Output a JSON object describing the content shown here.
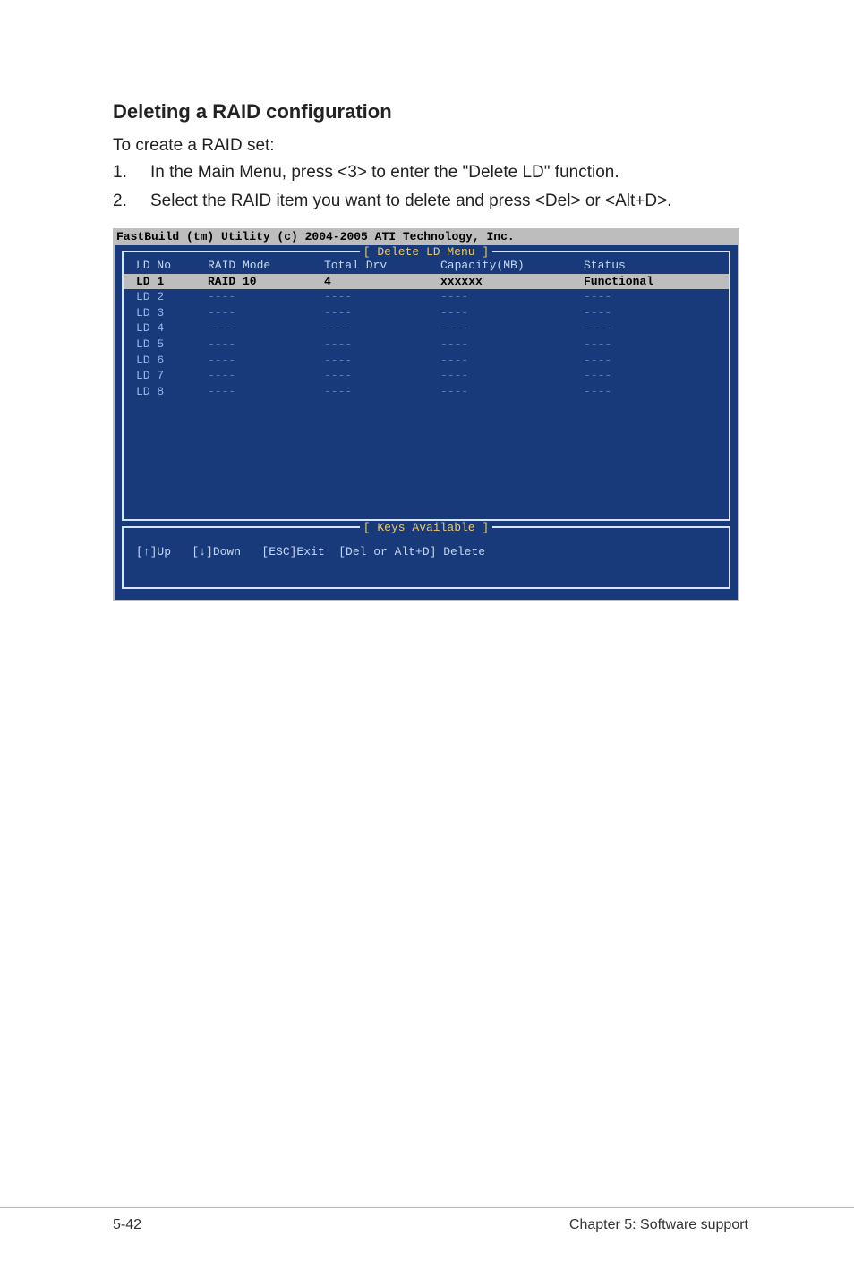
{
  "heading": "Deleting a RAID configuration",
  "intro": "To create a RAID set:",
  "steps": [
    {
      "num": "1.",
      "text": "In the Main Menu, press <3> to enter the \"Delete LD\" function."
    },
    {
      "num": "2.",
      "text": "Select the RAID item you want to delete and press <Del> or <Alt+D>."
    }
  ],
  "terminal": {
    "util_title": "FastBuild (tm) Utility (c) 2004-2005 ATI Technology, Inc.",
    "menu_title": "[ Delete LD Menu ]",
    "columns": {
      "c1": "LD No",
      "c2": "RAID Mode",
      "c3": "Total Drv",
      "c4": "Capacity(MB)",
      "c5": "Status"
    },
    "rows": [
      {
        "c1": "LD 1",
        "c2": "RAID 10",
        "c3": "4",
        "c4": "xxxxxx",
        "c5": "Functional",
        "selected": true
      },
      {
        "c1": "LD 2",
        "c2": "----",
        "c3": "----",
        "c4": "----",
        "c5": "----"
      },
      {
        "c1": "LD 3",
        "c2": "----",
        "c3": "----",
        "c4": "----",
        "c5": "----"
      },
      {
        "c1": "LD 4",
        "c2": "----",
        "c3": "----",
        "c4": "----",
        "c5": "----"
      },
      {
        "c1": "LD 5",
        "c2": "----",
        "c3": "----",
        "c4": "----",
        "c5": "----"
      },
      {
        "c1": "LD 6",
        "c2": "----",
        "c3": "----",
        "c4": "----",
        "c5": "----"
      },
      {
        "c1": "LD 7",
        "c2": "----",
        "c3": "----",
        "c4": "----",
        "c5": "----"
      },
      {
        "c1": "LD 8",
        "c2": "----",
        "c3": "----",
        "c4": "----",
        "c5": "----"
      }
    ],
    "keys_title": "[ Keys Available ]",
    "keys_line": "[↑]Up   [↓]Down   [ESC]Exit  [Del or Alt+D] Delete"
  },
  "footer": {
    "left": "5-42",
    "right": "Chapter 5: Software support"
  }
}
